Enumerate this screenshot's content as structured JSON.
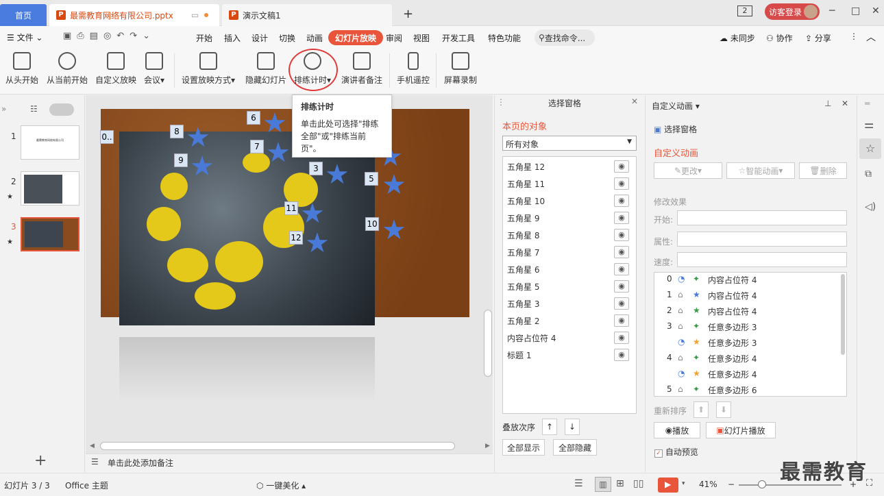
{
  "tabs": {
    "home": "首页",
    "doc1": "最需教育网络有限公司.pptx",
    "doc2": "演示文稿1",
    "new": "+"
  },
  "window": {
    "badge": "2",
    "login": "访客登录",
    "min": "─",
    "max": "□",
    "close": "✕"
  },
  "menu": {
    "file": "文件",
    "items": [
      "开始",
      "插入",
      "设计",
      "切换",
      "动画"
    ],
    "active": "幻灯片放映",
    "items2": [
      "审阅",
      "视图",
      "开发工具",
      "特色功能"
    ],
    "search": "查找命令...",
    "sync": "未同步",
    "collab": "协作",
    "share": "分享"
  },
  "ribbon": [
    "从头开始",
    "从当前开始",
    "自定义放映",
    "会议",
    "设置放映方式",
    "隐藏幻灯片",
    "排练计时",
    "演讲者备注",
    "手机遥控",
    "屏幕录制"
  ],
  "tooltip": {
    "title": "排练计时",
    "body": "单击此处可选择\"排练全部\"或\"排练当前页\"。"
  },
  "slides": [
    "1",
    "2",
    "3"
  ],
  "thumb1_text": "最需教育网络有限公司",
  "tags": [
    "0..",
    "8",
    "9",
    "6",
    "7",
    "3",
    "5",
    "11",
    "12",
    "10"
  ],
  "notes": "单击此处添加备注",
  "selpane": {
    "title": "选择窗格",
    "section": "本页的对象",
    "dropdown": "所有对象",
    "objects": [
      "五角星 12",
      "五角星 11",
      "五角星 10",
      "五角星 9",
      "五角星 8",
      "五角星 7",
      "五角星 6",
      "五角星 5",
      "五角星 3",
      "五角星 2",
      "内容占位符 4",
      "标题 1"
    ],
    "order": "叠放次序",
    "show_all": "全部显示",
    "hide_all": "全部隐藏"
  },
  "animpane": {
    "title": "自定义动画",
    "selpane": "选择窗格",
    "section": "自定义动画",
    "change": "更改",
    "smart": "智能动画",
    "delete": "删除",
    "modify": "修改效果",
    "start": "开始:",
    "prop": "属性:",
    "speed": "速度:",
    "rows": [
      [
        "0",
        "内容占位符 4"
      ],
      [
        "1",
        "内容占位符 4"
      ],
      [
        "2",
        "内容占位符 4"
      ],
      [
        "3",
        "任意多边形 3"
      ],
      [
        "",
        "任意多边形 3"
      ],
      [
        "4",
        "任意多边形 4"
      ],
      [
        "",
        "任意多边形 4"
      ],
      [
        "5",
        "任意多边形 6"
      ]
    ],
    "reorder": "重新排序",
    "play": "播放",
    "slideshow": "幻灯片播放",
    "autopreview": "自动预览"
  },
  "status": {
    "slide": "幻灯片 3 / 3",
    "theme": "Office 主题",
    "beautify": "一键美化",
    "zoom": "41%"
  },
  "watermark": "最需教育"
}
